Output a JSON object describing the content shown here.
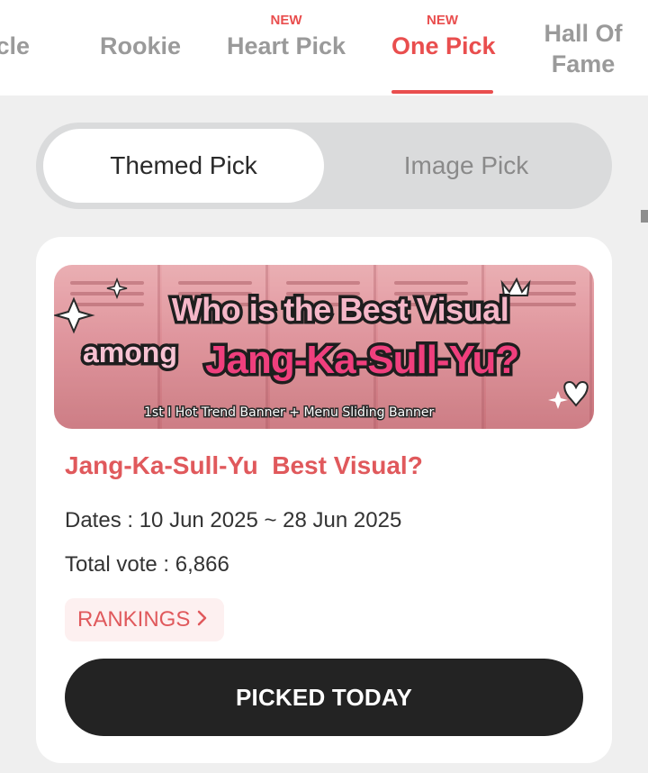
{
  "tabs": [
    {
      "id": "miracle",
      "label": "racle",
      "badge": "",
      "active": false
    },
    {
      "id": "rookie",
      "label": "Rookie",
      "badge": "",
      "active": false
    },
    {
      "id": "heart",
      "label": "Heart Pick",
      "badge": "NEW",
      "active": false
    },
    {
      "id": "one",
      "label": "One Pick",
      "badge": "NEW",
      "active": true
    },
    {
      "id": "hall",
      "label": "Hall Of Fame",
      "badge": "",
      "active": false
    }
  ],
  "segment": {
    "themed_label": "Themed Pick",
    "image_label": "Image Pick",
    "selected": "Themed Pick"
  },
  "card": {
    "banner": {
      "line1": "Who is the Best Visual",
      "line2_prefix": "among",
      "line2_highlight": "Jang-Ka-Sull-Yu?",
      "caption": "1st I Hot Trend Banner + Menu Sliding Banner"
    },
    "title": "Jang-Ka-Sull-Yu  Best Visual?",
    "dates": "Dates : 10 Jun 2025 ~ 28 Jun 2025",
    "total_vote": "Total vote : 6,866",
    "rankings_label": "RANKINGS",
    "rankings_icon": "chevron-right-icon",
    "picked_label": "PICKED TODAY"
  },
  "colors": {
    "accent": "#e94e4e",
    "title_red": "#e0595c",
    "inactive_tab": "#9a9a9a",
    "background": "#efefef",
    "segment_track": "#dadbdc",
    "button_dark": "#232323"
  }
}
